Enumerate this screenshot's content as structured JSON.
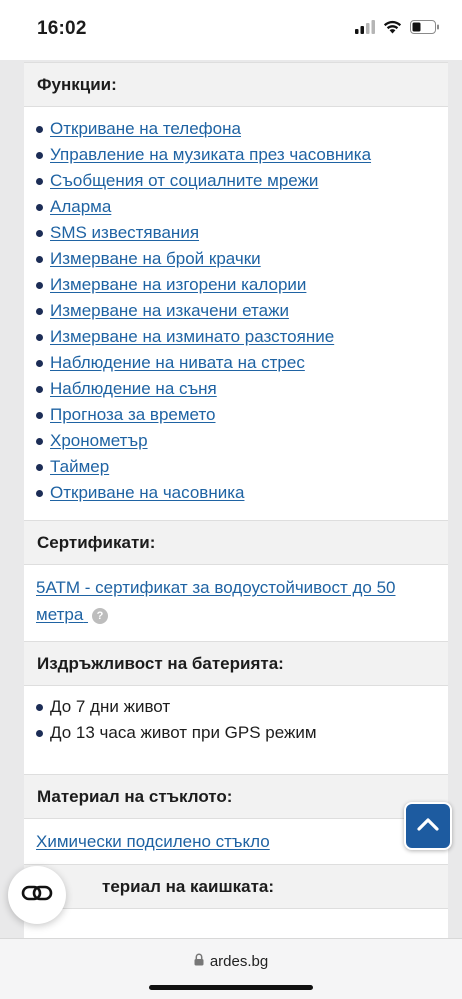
{
  "status": {
    "time": "16:02"
  },
  "features": {
    "title": "Функции:",
    "items": [
      "Откриване на телефона",
      "Управление на музиката през часовника",
      "Съобщения от социалните мрежи",
      "Аларма",
      "SMS известявания",
      "Измерване на брой крачки",
      "Измерване на изгорени калории",
      "Измерване на изкачени етажи",
      "Измерване на изминато разстояние",
      "Наблюдение на нивата на стрес",
      "Наблюдение на съня",
      "Прогноза за времето",
      "Хронометър",
      "Таймер",
      "Откриване на часовника"
    ]
  },
  "certificates": {
    "title": "Сертификати:",
    "link_line1": "5ATM - сертификат за водоустойчивост до 50",
    "link_line2": "метра",
    "help": "?"
  },
  "battery": {
    "title": "Издръжливост на батерията:",
    "items": [
      "До 7 дни живот",
      "До 13 часа живот при GPS режим"
    ]
  },
  "glass": {
    "title": "Материал на стъклото:",
    "value": "Химически подсилено стъкло"
  },
  "strap": {
    "title": "Материал на каишката:",
    "title_visible": "териал на каишката:"
  },
  "browser": {
    "url": "ardes.bg"
  },
  "icons": {
    "signal": "cellular-signal-icon",
    "wifi": "wifi-icon",
    "battery": "battery-icon",
    "lock": "lock-icon",
    "scroll_top": "chevron-up-icon",
    "floating": "link-icon"
  },
  "colors": {
    "link": "#1f63a3",
    "accent": "#1d5ba0"
  }
}
